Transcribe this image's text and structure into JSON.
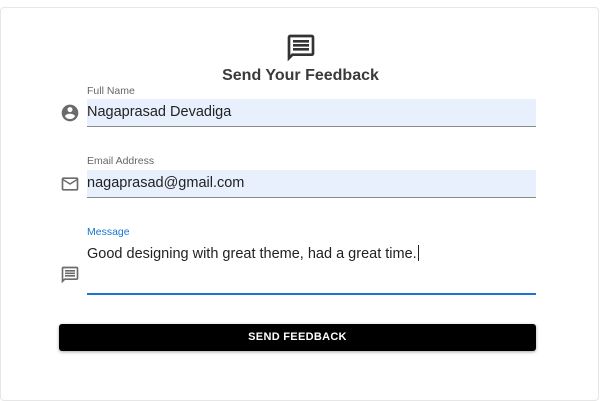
{
  "form": {
    "title": "Send Your Feedback",
    "header_icon": "message-icon",
    "fields": {
      "name": {
        "label": "Full Name",
        "value": "Nagaprasad Devadiga",
        "icon": "account-circle-icon"
      },
      "email": {
        "label": "Email Address",
        "value": "nagaprasad@gmail.com",
        "icon": "mail-icon"
      },
      "message": {
        "label": "Message",
        "value": "Good designing with great theme, had a great time.",
        "icon": "comment-icon"
      }
    },
    "submit_label": "SEND FEEDBACK"
  },
  "colors": {
    "accent": "#1976d2",
    "input_fill": "#e8f0fe",
    "button_bg": "#000000",
    "title_text": "#3a3a3a"
  }
}
